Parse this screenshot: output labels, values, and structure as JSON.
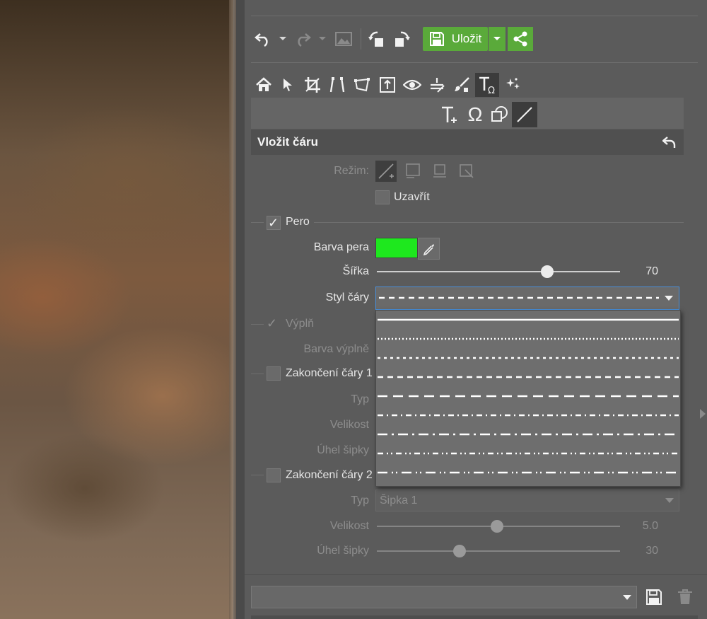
{
  "toolbar": {
    "save_label": "Uložit",
    "icons": [
      "undo-icon",
      "redo-icon",
      "image-icon",
      "rotate-left-icon",
      "rotate-right-icon",
      "save-disk-icon",
      "share-icon"
    ]
  },
  "tools": {
    "items": [
      "home-icon",
      "pointer-icon",
      "crop-icon",
      "perspective-icon",
      "transform-icon",
      "resize-icon",
      "eye-icon",
      "levels-icon",
      "brush-icon",
      "text-symbol-icon",
      "effects-icon"
    ],
    "active": "text-symbol-icon"
  },
  "subtools": {
    "items": [
      "add-text-icon",
      "symbol-omega-icon",
      "shape-icon",
      "line-icon"
    ],
    "active": "line-icon"
  },
  "section": {
    "title": "Vložit čáru"
  },
  "mode": {
    "label": "Režim:",
    "close_label": "Uzavřít"
  },
  "pen": {
    "label": "Pero",
    "color_label": "Barva pera",
    "color": "#1ee81e",
    "width_label": "Šířka",
    "width_value": "70",
    "width_fraction": 0.7,
    "style_label": "Styl čáry"
  },
  "fill": {
    "label": "Výplň",
    "color_label": "Barva výplně"
  },
  "end1": {
    "label": "Zakončení čáry 1",
    "type_label": "Typ",
    "size_label": "Velikost",
    "angle_label": "Úhel šipky"
  },
  "end2": {
    "label": "Zakončení čáry 2",
    "type_label": "Typ",
    "type_value": "Šipka 1",
    "size_label": "Velikost",
    "size_value": "5.0",
    "angle_label": "Úhel šipky",
    "angle_value": "30"
  },
  "line_styles": [
    "solid",
    "dotted",
    "short-dash",
    "dash",
    "long-dash",
    "dash-dot",
    "long-dash-dot",
    "dash-dot-dot",
    "long-dash-dot-dot"
  ],
  "colors": {
    "accent_green": "#5aaa3a",
    "pen_green": "#1ee81e",
    "panel": "#5b5b5b"
  }
}
